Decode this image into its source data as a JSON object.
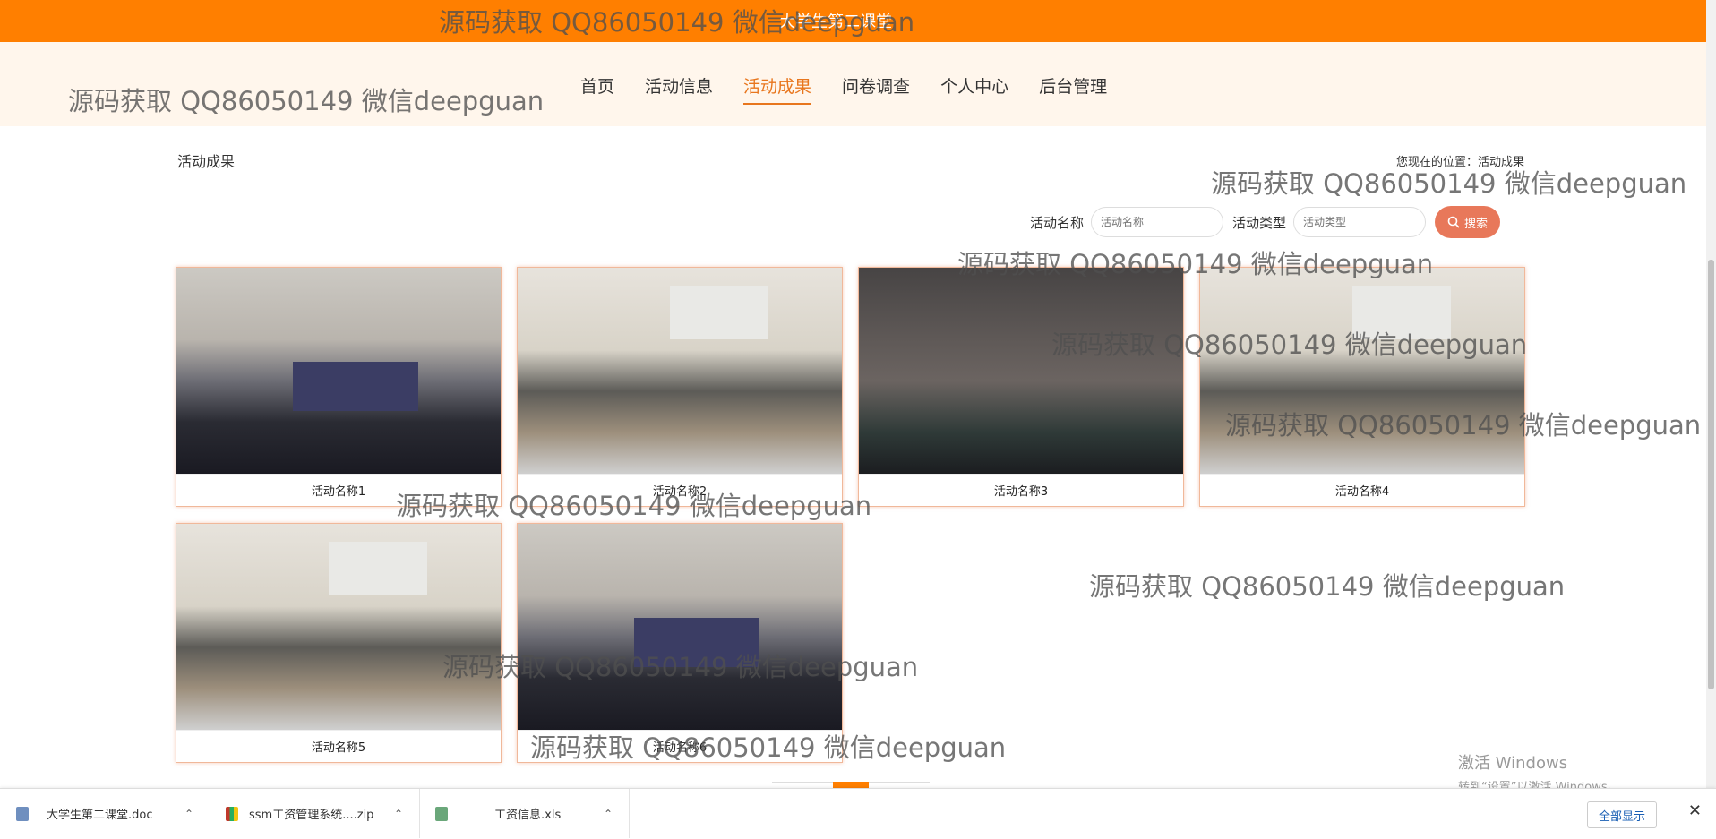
{
  "header": {
    "site_title": "大学生第二课堂"
  },
  "nav": [
    "首页",
    "活动信息",
    "活动成果",
    "问卷调查",
    "个人中心",
    "后台管理"
  ],
  "page": {
    "heading": "活动成果",
    "breadcrumb": "您现在的位置：活动成果"
  },
  "search": {
    "name_label": "活动名称",
    "name_placeholder": "活动名称",
    "type_label": "活动类型",
    "type_placeholder": "活动类型",
    "button": "搜索"
  },
  "cards": [
    "活动名称1",
    "活动名称2",
    "活动名称3",
    "活动名称4",
    "活动名称5",
    "活动名称6"
  ],
  "watermark": "源码获取 QQ86050149 微信deepguan",
  "windows": {
    "line1": "激活 Windows",
    "line2": "转到“设置”以激活 Windows。"
  },
  "downloads": {
    "items": [
      "大学生第二课堂.doc",
      "ssm工资管理系统....zip",
      "工资信息.xls"
    ],
    "show_all": "全部显示"
  }
}
